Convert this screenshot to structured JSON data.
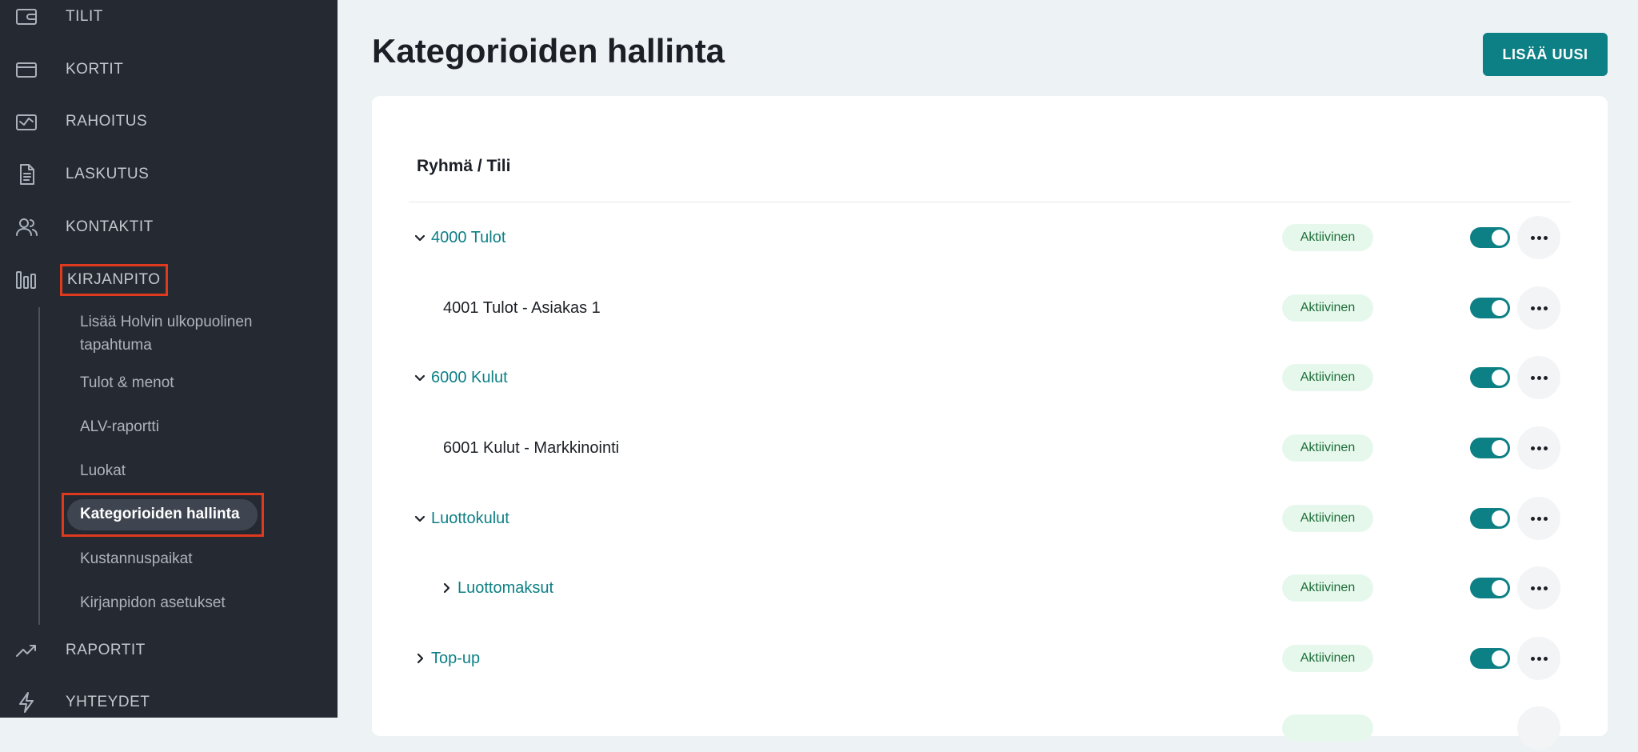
{
  "sidebar": {
    "nav_top": [
      {
        "label": "TILIT",
        "icon": "wallet-icon"
      },
      {
        "label": "KORTIT",
        "icon": "credit-card-icon"
      },
      {
        "label": "RAHOITUS",
        "icon": "financing-icon"
      },
      {
        "label": "LASKUTUS",
        "icon": "invoice-icon"
      },
      {
        "label": "KONTAKTIT",
        "icon": "contacts-icon"
      },
      {
        "label": "KIRJANPITO",
        "icon": "bar-chart-icon"
      }
    ],
    "submenu": [
      {
        "label": "Lisää Holvin ulkopuolinen tapahtuma"
      },
      {
        "label": "Tulot & menot"
      },
      {
        "label": "ALV-raportti"
      },
      {
        "label": "Luokat"
      },
      {
        "label": "Kategorioiden hallinta",
        "active": true
      },
      {
        "label": "Kustannuspaikat"
      },
      {
        "label": "Kirjanpidon asetukset"
      }
    ],
    "nav_bottom": [
      {
        "label": "RAPORTIT",
        "icon": "trending-up-icon"
      },
      {
        "label": "YHTEYDET",
        "icon": "lightning-icon"
      }
    ]
  },
  "main": {
    "title": "Kategorioiden hallinta",
    "add_button_label": "LISÄÄ UUSI",
    "column_header": "Ryhmä / Tili",
    "rows": [
      {
        "label": "4000 Tulot",
        "status": "Aktiivinen",
        "expander": "expanded",
        "enabled": true
      },
      {
        "label": "4001 Tulot - Asiakas 1",
        "status": "Aktiivinen",
        "expander": "none",
        "enabled": true
      },
      {
        "label": "6000 Kulut",
        "status": "Aktiivinen",
        "expander": "expanded",
        "enabled": true
      },
      {
        "label": "6001 Kulut - Markkinointi",
        "status": "Aktiivinen",
        "expander": "none",
        "enabled": true
      },
      {
        "label": "Luottokulut",
        "status": "Aktiivinen",
        "expander": "expanded",
        "enabled": true
      },
      {
        "label": "Luottomaksut",
        "status": "Aktiivinen",
        "expander": "collapsed",
        "enabled": true
      },
      {
        "label": "Top-up",
        "status": "Aktiivinen",
        "expander": "collapsed",
        "enabled": true
      }
    ]
  },
  "colors": {
    "sidebar_bg": "#252a32",
    "accent": "#0d8085",
    "status_bg": "#e6f8ec",
    "status_text": "#1f6e3a",
    "highlight_box": "#e03a1e"
  }
}
